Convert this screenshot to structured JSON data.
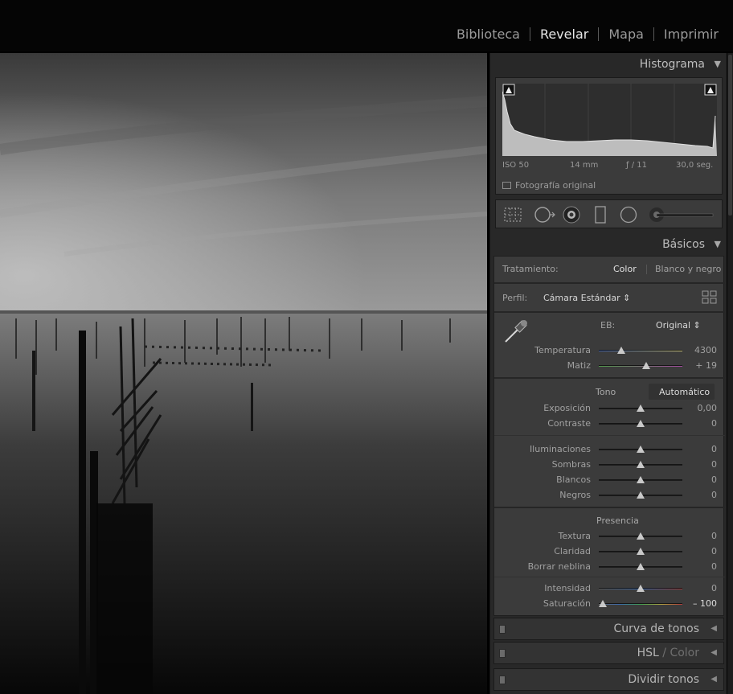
{
  "modules": [
    {
      "label": "Biblioteca",
      "active": false
    },
    {
      "label": "Revelar",
      "active": true
    },
    {
      "label": "Mapa",
      "active": false
    },
    {
      "label": "Imprimir",
      "active": false
    }
  ],
  "histogram": {
    "title": "Histograma",
    "iso": "ISO 50",
    "focal": "14 mm",
    "aperture": "ƒ / 11",
    "shutter": "30,0 seg.",
    "original_label": "Fotografía original"
  },
  "tools": [
    "crop-overlay-icon",
    "spot-removal-icon",
    "red-eye-icon",
    "graduated-filter-icon",
    "radial-filter-icon",
    "adjustment-brush-icon"
  ],
  "basics": {
    "title": "Básicos",
    "treatment_label": "Tratamiento:",
    "treatment_color": "Color",
    "treatment_bw": "Blanco y negro",
    "profile_label": "Perfil:",
    "profile_value": "Cámara Estándar ⇕",
    "wb_label": "EB:",
    "wb_value": "Original ⇕",
    "temp": {
      "label": "Temperatura",
      "value": "4300",
      "pos": 0.27
    },
    "tint": {
      "label": "Matiz",
      "value": "+ 19",
      "pos": 0.57
    },
    "tone_label": "Tono",
    "auto_label": "Automático",
    "exposure": {
      "label": "Exposición",
      "value": "0,00",
      "pos": 0.5
    },
    "contrast": {
      "label": "Contraste",
      "value": "0",
      "pos": 0.5
    },
    "highlights": {
      "label": "Iluminaciones",
      "value": "0",
      "pos": 0.5
    },
    "shadows": {
      "label": "Sombras",
      "value": "0",
      "pos": 0.5
    },
    "whites": {
      "label": "Blancos",
      "value": "0",
      "pos": 0.5
    },
    "blacks": {
      "label": "Negros",
      "value": "0",
      "pos": 0.5
    },
    "presence_label": "Presencia",
    "texture": {
      "label": "Textura",
      "value": "0",
      "pos": 0.5
    },
    "clarity": {
      "label": "Claridad",
      "value": "0",
      "pos": 0.5
    },
    "dehaze": {
      "label": "Borrar neblina",
      "value": "0",
      "pos": 0.5
    },
    "vibrance": {
      "label": "Intensidad",
      "value": "0",
      "pos": 0.5
    },
    "saturation": {
      "label": "Saturación",
      "value": "– 100",
      "pos": 0.05
    }
  },
  "collapsed_panels": {
    "tone_curve": "Curva de tonos",
    "hsl": "HSL",
    "hsl_sep": " / ",
    "hsl_color": "Color",
    "split_toning": "Dividir tonos"
  },
  "colors": {
    "panel_bg": "#282828",
    "section_bg": "#3b3b3b",
    "text": "#a0a0a0",
    "active_text": "#e6e6e6"
  }
}
